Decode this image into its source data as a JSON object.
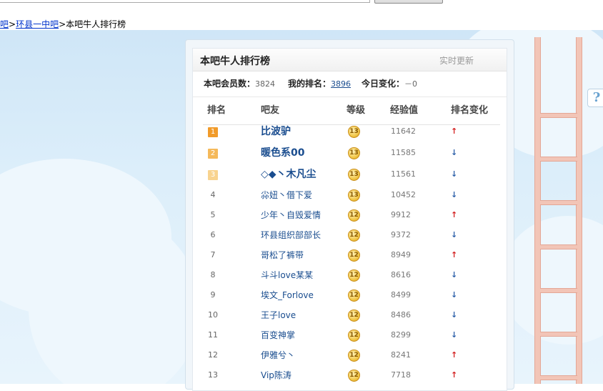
{
  "breadcrumb": {
    "part1": "吧",
    "link": "环县一中吧",
    "current": "本吧牛人排行榜",
    "sep": ">"
  },
  "panel": {
    "title": "本吧牛人排行榜",
    "update_label": "实时更新"
  },
  "summary": {
    "members_label": "本吧会员数：",
    "members_value": "3824",
    "my_rank_label": "我的排名：",
    "my_rank_value": "3896",
    "today_change_label": "今日变化：",
    "today_change_value": "－0"
  },
  "table": {
    "headers": {
      "rank": "排名",
      "user": "吧友",
      "level": "等级",
      "exp": "经验值",
      "change": "排名变化"
    },
    "rows": [
      {
        "rank": "1",
        "name": "比波驴",
        "level": "13",
        "exp": "11642",
        "change": "up"
      },
      {
        "rank": "2",
        "name": "暖色系00",
        "level": "13",
        "exp": "11585",
        "change": "down"
      },
      {
        "rank": "3",
        "name": "◇◆丶木凡尘",
        "level": "13",
        "exp": "11561",
        "change": "down"
      },
      {
        "rank": "4",
        "name": "尛妞丶借下爱",
        "level": "13",
        "exp": "10452",
        "change": "down"
      },
      {
        "rank": "5",
        "name": "少年丶自毁爱情",
        "level": "12",
        "exp": "9912",
        "change": "up"
      },
      {
        "rank": "6",
        "name": "环县组织部部长",
        "level": "12",
        "exp": "9372",
        "change": "down"
      },
      {
        "rank": "7",
        "name": "哥松了裤带",
        "level": "12",
        "exp": "8949",
        "change": "up"
      },
      {
        "rank": "8",
        "name": "斗斗love某某",
        "level": "12",
        "exp": "8616",
        "change": "down"
      },
      {
        "rank": "9",
        "name": "埃文_Forlove",
        "level": "12",
        "exp": "8499",
        "change": "down"
      },
      {
        "rank": "10",
        "name": "王子love",
        "level": "12",
        "exp": "8486",
        "change": "down"
      },
      {
        "rank": "11",
        "name": "百变神掌",
        "level": "12",
        "exp": "8299",
        "change": "down"
      },
      {
        "rank": "12",
        "name": "伊雅兮丶",
        "level": "12",
        "exp": "8241",
        "change": "up"
      },
      {
        "rank": "13",
        "name": "Vip陈涛",
        "level": "12",
        "exp": "7718",
        "change": "up"
      }
    ]
  },
  "colors": {
    "rank1": "#f19b2a",
    "rank2": "#f5b95a",
    "rank3": "#f8d38f",
    "up_arrow": "#d32020",
    "down_arrow": "#2a5ea8",
    "link": "#1a4d8f"
  },
  "help_icon": "?"
}
